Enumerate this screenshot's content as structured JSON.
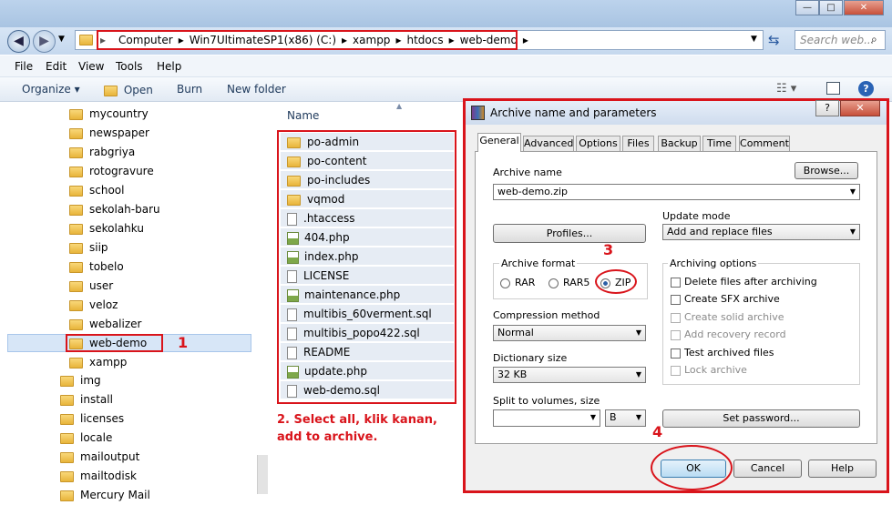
{
  "window": {
    "min_label": "—",
    "max_label": "□",
    "close_label": "✕"
  },
  "address": {
    "crumbs": [
      "Computer",
      "Win7UltimateSP1(x86) (C:)",
      "xampp",
      "htdocs",
      "web-demo"
    ],
    "separator": "▸",
    "search_placeholder": "Search web..."
  },
  "menu": [
    "File",
    "Edit",
    "View",
    "Tools",
    "Help"
  ],
  "toolbar": {
    "organize": "Organize ▾",
    "open": "Open",
    "burn": "Burn",
    "new_folder": "New folder"
  },
  "nav_tree": {
    "sub": [
      "mycountry",
      "newspaper",
      "rabgriya",
      "rotogravure",
      "school",
      "sekolah-baru",
      "sekolahku",
      "siip",
      "tobelo",
      "user",
      "veloz",
      "webalizer",
      "web-demo",
      "xampp"
    ],
    "top": [
      "img",
      "install",
      "licenses",
      "locale",
      "mailoutput",
      "mailtodisk",
      "Mercury Mail"
    ],
    "selected": "web-demo"
  },
  "files": {
    "column": "Name",
    "items": [
      {
        "name": "po-admin",
        "type": "folder"
      },
      {
        "name": "po-content",
        "type": "folder"
      },
      {
        "name": "po-includes",
        "type": "folder"
      },
      {
        "name": "vqmod",
        "type": "folder"
      },
      {
        "name": ".htaccess",
        "type": "file"
      },
      {
        "name": "404.php",
        "type": "php"
      },
      {
        "name": "index.php",
        "type": "php"
      },
      {
        "name": "LICENSE",
        "type": "file"
      },
      {
        "name": "maintenance.php",
        "type": "php"
      },
      {
        "name": "multibis_60verment.sql",
        "type": "file"
      },
      {
        "name": "multibis_popo422.sql",
        "type": "file"
      },
      {
        "name": "README",
        "type": "file"
      },
      {
        "name": "update.php",
        "type": "php"
      },
      {
        "name": "web-demo.sql",
        "type": "file"
      }
    ]
  },
  "annotations": {
    "n1": "1",
    "n3": "3",
    "n4": "4",
    "n2": "2. Select all, klik kanan, add to archive."
  },
  "dialog": {
    "title": "Archive name and parameters",
    "help_label": "?",
    "close_label": "✕",
    "tabs": [
      "General",
      "Advanced",
      "Options",
      "Files",
      "Backup",
      "Time",
      "Comment"
    ],
    "active_tab": "General",
    "archive_name_label": "Archive name",
    "archive_name": "web-demo.zip",
    "browse": "Browse...",
    "profiles": "Profiles...",
    "update_mode_label": "Update mode",
    "update_mode": "Add and replace files",
    "format_label": "Archive format",
    "formats": [
      "RAR",
      "RAR5",
      "ZIP"
    ],
    "selected_format": "ZIP",
    "compression_label": "Compression method",
    "compression": "Normal",
    "dict_label": "Dictionary size",
    "dict": "32 KB",
    "split_label": "Split to volumes, size",
    "split_value": "",
    "split_unit": "B",
    "options_label": "Archiving options",
    "options": [
      {
        "label": "Delete files after archiving",
        "checked": false,
        "disabled": false
      },
      {
        "label": "Create SFX archive",
        "checked": false,
        "disabled": false
      },
      {
        "label": "Create solid archive",
        "checked": false,
        "disabled": true
      },
      {
        "label": "Add recovery record",
        "checked": false,
        "disabled": true
      },
      {
        "label": "Test archived files",
        "checked": false,
        "disabled": false
      },
      {
        "label": "Lock archive",
        "checked": false,
        "disabled": true
      }
    ],
    "set_password": "Set password...",
    "ok": "OK",
    "cancel": "Cancel",
    "help": "Help"
  }
}
